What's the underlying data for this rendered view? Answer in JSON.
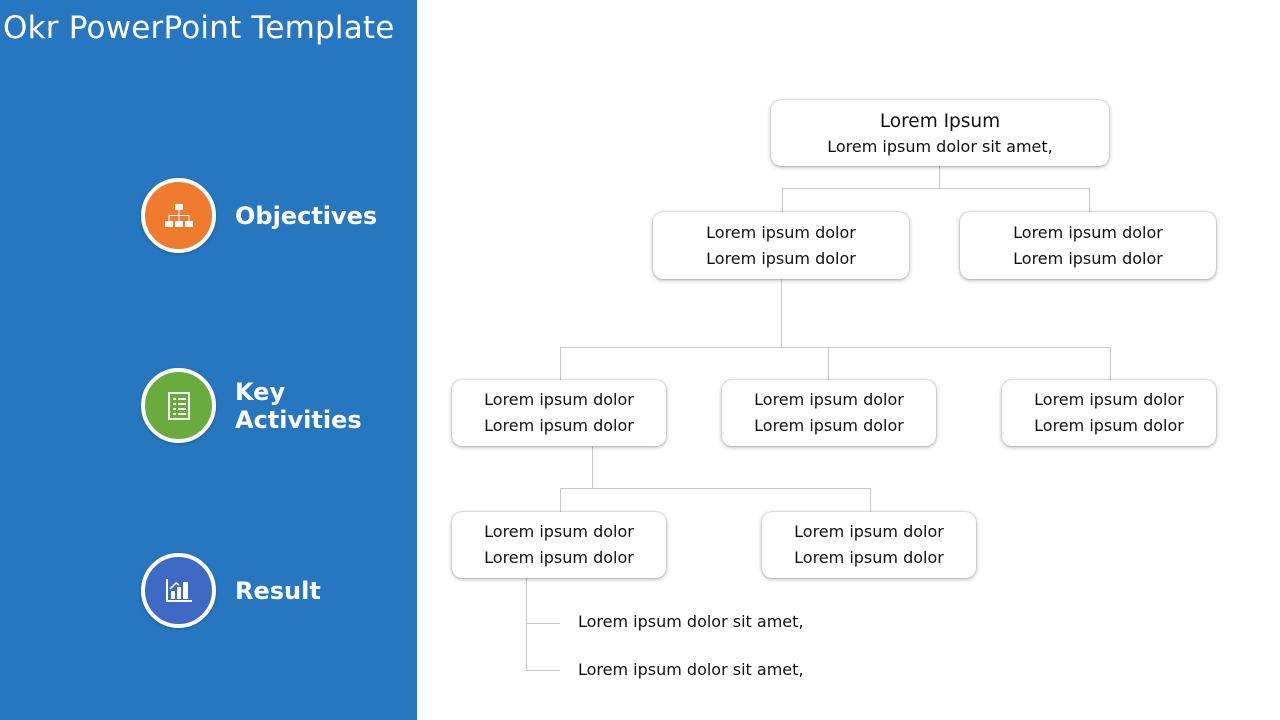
{
  "slide": {
    "title": "Okr PowerPoint Template",
    "colors": {
      "sidebar": "#2777c0",
      "objectives": "#ef7b2f",
      "key_activities": "#6aab3e",
      "result": "#3f6ac3"
    }
  },
  "okr_items": [
    {
      "label_lines": [
        "Objectives"
      ],
      "icon": "hierarchy-icon"
    },
    {
      "label_lines": [
        "Key",
        "Activities"
      ],
      "icon": "checklist-icon"
    },
    {
      "label_lines": [
        "Result"
      ],
      "icon": "bar-chart-icon"
    }
  ],
  "org_chart": {
    "root": {
      "title": "Lorem Ipsum",
      "subtitle": "Lorem ipsum dolor sit amet,"
    },
    "level1": [
      {
        "line1": "Lorem ipsum dolor",
        "line2": "Lorem ipsum dolor"
      },
      {
        "line1": "Lorem ipsum dolor",
        "line2": "Lorem ipsum dolor"
      }
    ],
    "level2": [
      {
        "line1": "Lorem ipsum dolor",
        "line2": "Lorem ipsum dolor"
      },
      {
        "line1": "Lorem ipsum dolor",
        "line2": "Lorem ipsum dolor"
      },
      {
        "line1": "Lorem ipsum dolor",
        "line2": "Lorem ipsum dolor"
      }
    ],
    "level3": [
      {
        "line1": "Lorem ipsum dolor",
        "line2": "Lorem ipsum dolor"
      },
      {
        "line1": "Lorem ipsum dolor",
        "line2": "Lorem ipsum dolor"
      }
    ],
    "bullets": [
      "Lorem ipsum dolor sit amet,",
      "Lorem ipsum dolor sit amet,"
    ]
  }
}
